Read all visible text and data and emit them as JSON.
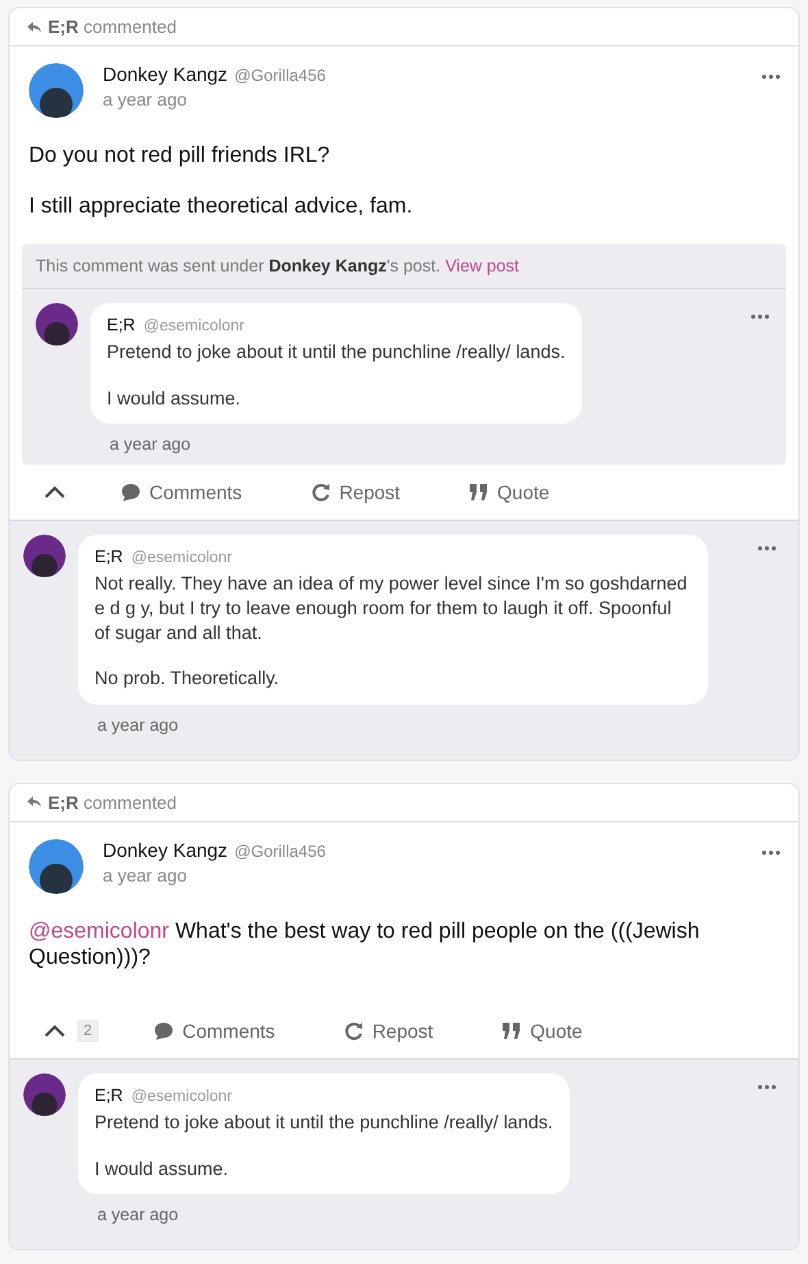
{
  "cards": [
    {
      "header": {
        "actor": "E;R",
        "action": "commented"
      },
      "post": {
        "author": "Donkey Kangz",
        "handle": "@Gorilla456",
        "time": "a year ago",
        "avatar": {
          "color": "#3d8fe6"
        },
        "paragraphs": [
          "Do you not red pill friends IRL?",
          "I still appreciate theoretical advice, fam."
        ]
      },
      "context": {
        "note": "This comment was sent under **Donkey Kangz**'s post.",
        "link": "View post",
        "comment": {
          "author": "E;R",
          "handle": "@esemicolonr",
          "time": "a year ago",
          "avatar": {
            "color": "#6a2a8a"
          },
          "paragraphs": [
            "Pretend to joke about it until the punchline /really/ lands.",
            "I would assume."
          ]
        }
      },
      "actions": {
        "labels": [
          "Comments",
          "Repost",
          "Quote"
        ]
      },
      "reply": {
        "author": "E;R",
        "handle": "@esemicolonr",
        "time": "a year ago",
        "avatar": {
          "color": "#6a2a8a"
        },
        "paragraphs": [
          "Not really. They have an idea of my power level since I'm so goshdarned e d g y, but I try to leave enough room for them to laugh it off. Spoonful of sugar and all that.",
          "No prob. Theoretically."
        ]
      }
    },
    {
      "header": {
        "actor": "E;R",
        "action": "commented"
      },
      "post": {
        "author": "Donkey Kangz",
        "handle": "@Gorilla456",
        "time": "a year ago",
        "avatar": {
          "color": "#3d8fe6"
        },
        "mention": "@esemicolonr",
        "paragraphs": [
          "What's the best way to red pill people on the (((Jewish Question)))?"
        ]
      },
      "actions": {
        "count": "2",
        "labels": [
          "Comments",
          "Repost",
          "Quote"
        ]
      },
      "reply": {
        "author": "E;R",
        "handle": "@esemicolonr",
        "time": "a year ago",
        "avatar": {
          "color": "#6a2a8a"
        },
        "paragraphs": [
          "Pretend to joke about it until the punchline /really/ lands.",
          "I would assume."
        ]
      }
    }
  ]
}
